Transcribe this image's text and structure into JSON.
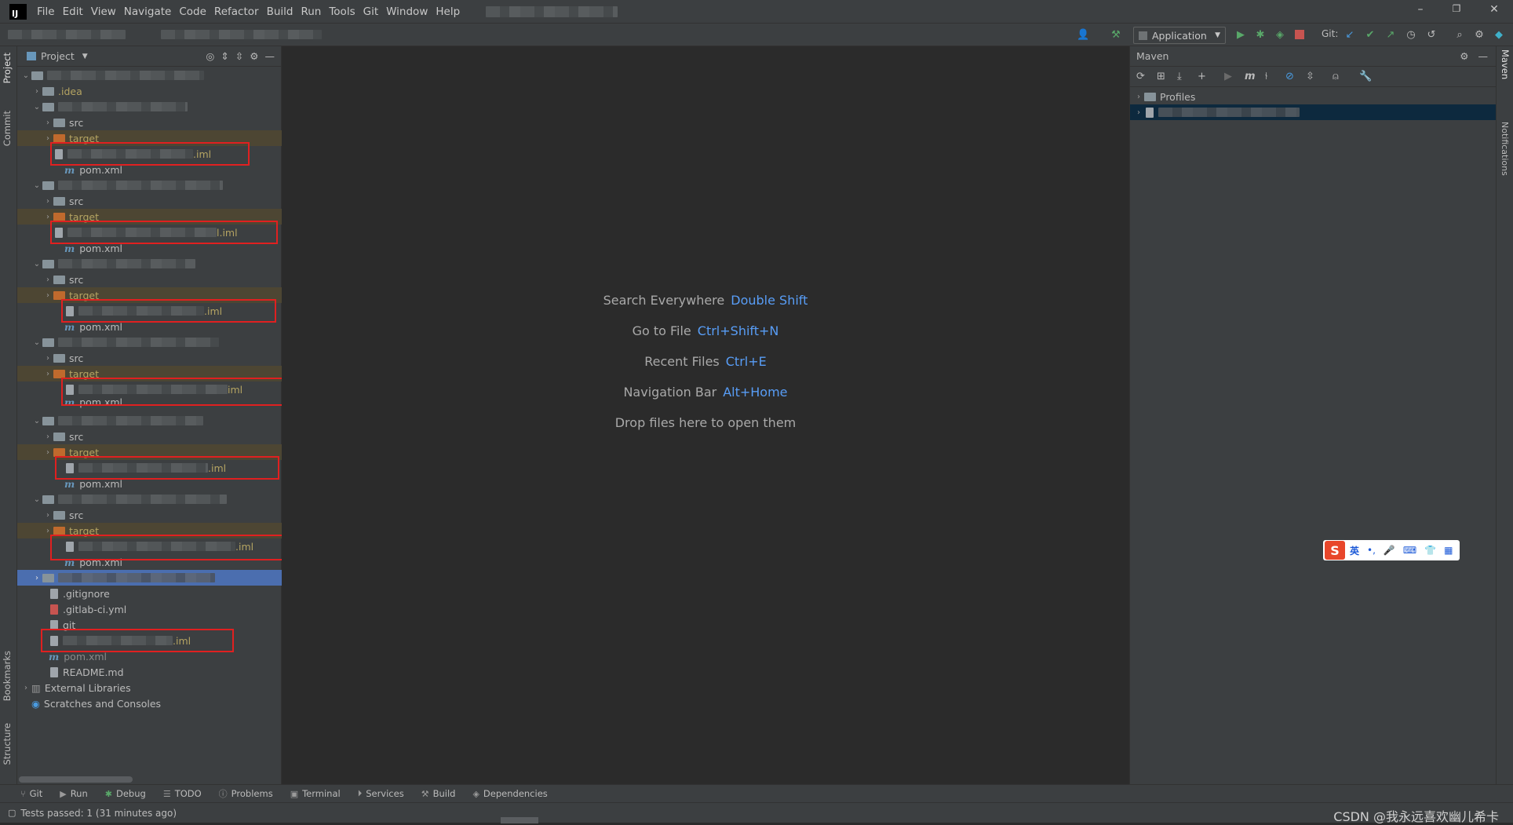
{
  "menubar": {
    "logo": "IJ",
    "items": [
      "File",
      "Edit",
      "View",
      "Navigate",
      "Code",
      "Refactor",
      "Build",
      "Run",
      "Tools",
      "Git",
      "Window",
      "Help"
    ]
  },
  "window_controls": {
    "minimize": "–",
    "restore": "❐",
    "close": "✕"
  },
  "toolbar": {
    "run_config": "Application",
    "git_label": "Git:"
  },
  "left_strip": {
    "tabs": [
      "Project",
      "Commit",
      "Bookmarks",
      "Structure"
    ]
  },
  "right_strip": {
    "tabs": [
      "Maven",
      "Notifications"
    ]
  },
  "project": {
    "header": "Project",
    "modules": [
      {
        "src": "src",
        "target": "target",
        "iml": ".iml",
        "pom": "pom.xml"
      },
      {
        "src": "src",
        "target": "target",
        "iml": "l.iml",
        "pom": "pom.xml"
      },
      {
        "src": "src",
        "target": "target",
        "iml": ".iml",
        "pom": "pom.xml"
      },
      {
        "src": "src",
        "target": "target",
        "iml": "iml",
        "pom": "pom.xml"
      },
      {
        "src": "src",
        "target": "target",
        "iml": ".iml",
        "pom": "pom.xml"
      },
      {
        "src": "src",
        "target": "target",
        "iml": ".iml",
        "pom": "pom.xml"
      }
    ],
    "idea": ".idea",
    "root_files": [
      ".gitignore",
      ".gitlab-ci.yml",
      "git"
    ],
    "root_iml": ".iml",
    "root_pom": "pom.xml",
    "readme": "README.md",
    "external": "External Libraries",
    "scratches": "Scratches and Consoles"
  },
  "editor_hints": [
    {
      "label": "Search Everywhere",
      "key": "Double Shift"
    },
    {
      "label": "Go to File",
      "key": "Ctrl+Shift+N"
    },
    {
      "label": "Recent Files",
      "key": "Ctrl+E"
    },
    {
      "label": "Navigation Bar",
      "key": "Alt+Home"
    },
    {
      "label": "Drop files here to open them",
      "key": ""
    }
  ],
  "maven": {
    "title": "Maven",
    "profiles": "Profiles"
  },
  "bottom_tabs": [
    "Git",
    "Run",
    "Debug",
    "TODO",
    "Problems",
    "Terminal",
    "Services",
    "Build",
    "Dependencies"
  ],
  "status": {
    "text": "Tests passed: 1 (31 minutes ago)",
    "watermark": "CSDN @我永远喜欢幽儿希卡"
  },
  "ime": {
    "logo": "S",
    "lang": "英"
  },
  "colors": {
    "accent": "#589df6",
    "selection": "#4b6eaf",
    "highlight_box": "#e02020",
    "target_bg": "#4d4633"
  }
}
